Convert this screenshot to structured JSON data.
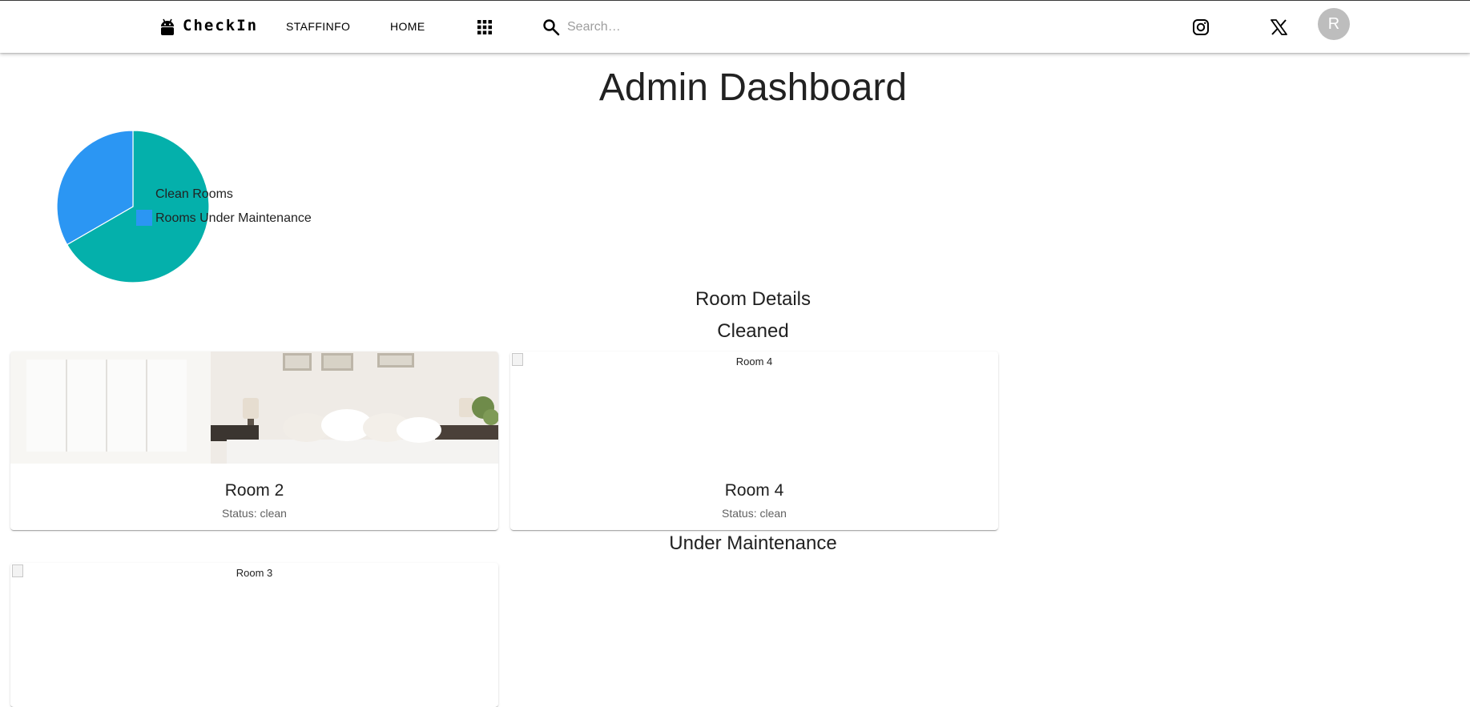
{
  "app": {
    "brand": "CheckIn",
    "nav": [
      "STAFFINFO",
      "HOME"
    ],
    "search_placeholder": "Search…",
    "avatar_initial": "R"
  },
  "page": {
    "title": "Admin Dashboard",
    "room_details": "Room Details",
    "cleaned_heading": "Cleaned",
    "maintenance_heading": "Under Maintenance"
  },
  "chart_data": {
    "type": "pie",
    "title": "",
    "labels": [
      "Clean Rooms",
      "Rooms Under Maintenance"
    ],
    "values": [
      2,
      1
    ],
    "colors": [
      "#04b0ab",
      "#2b96f3"
    ],
    "legend": "right"
  },
  "cleaned_rooms": [
    {
      "title": "Room 2",
      "status": "Status: clean",
      "image_alt": ""
    },
    {
      "title": "Room 4",
      "status": "Status: clean",
      "image_alt": "Room 4"
    }
  ],
  "maintenance_rooms": [
    {
      "title": "Room 3",
      "image_alt": "Room 3"
    }
  ],
  "icons": {
    "logo": "android-icon",
    "apps": "apps-grid-icon",
    "search": "search-icon",
    "social1": "instagram-icon",
    "social2": "x-icon"
  }
}
